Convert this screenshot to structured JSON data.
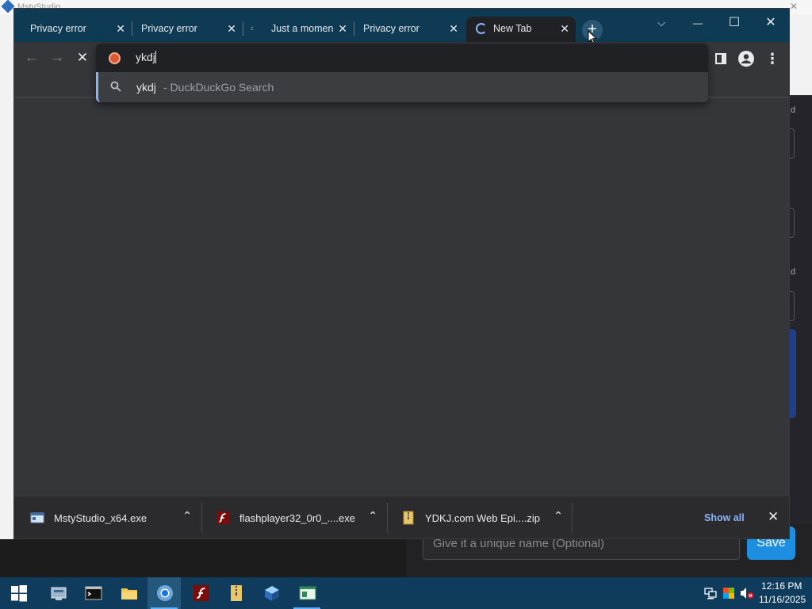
{
  "background_app": {
    "title": "MstyStudio",
    "side_labels": [
      "d",
      "d"
    ],
    "name_placeholder": "Give it a unique name (Optional)",
    "save_label": "Save"
  },
  "tabs": [
    {
      "title": "Privacy error",
      "close": "✕",
      "active": false
    },
    {
      "title": "Privacy error",
      "close": "✕",
      "active": false
    },
    {
      "title": "Just a moment...",
      "close": "✕",
      "active": false
    },
    {
      "title": "Privacy error",
      "close": "✕",
      "active": false
    },
    {
      "title": "New Tab",
      "close": "✕",
      "active": true
    }
  ],
  "new_tab_symbol": "+",
  "window_controls": {
    "tab_search": "⌵",
    "minimize": "—",
    "maximize": "☐",
    "close": "✕"
  },
  "toolbar": {
    "back": "←",
    "forward": "→",
    "stop": "✕",
    "menu": "⋮"
  },
  "omnibox": {
    "value": "ykdj",
    "suggestion_query": "ykdj",
    "suggestion_desc": "- DuckDuckGo Search"
  },
  "downloads": [
    {
      "name": "MstyStudio_x64.exe"
    },
    {
      "name": "flashplayer32_0r0_....exe"
    },
    {
      "name": "YDKJ.com Web Epi....zip"
    }
  ],
  "download_caret": "⌃",
  "show_all_label": "Show all",
  "download_close": "✕",
  "taskbar": {
    "clock_time": "12:16 PM",
    "clock_date": "11/16/2025"
  },
  "colors": {
    "tabstrip": "#0e3a54",
    "toolbar": "#35363a",
    "accent": "#8ab4f8",
    "taskbar": "#0f3c5c",
    "save_button": "#1e8fe0"
  }
}
